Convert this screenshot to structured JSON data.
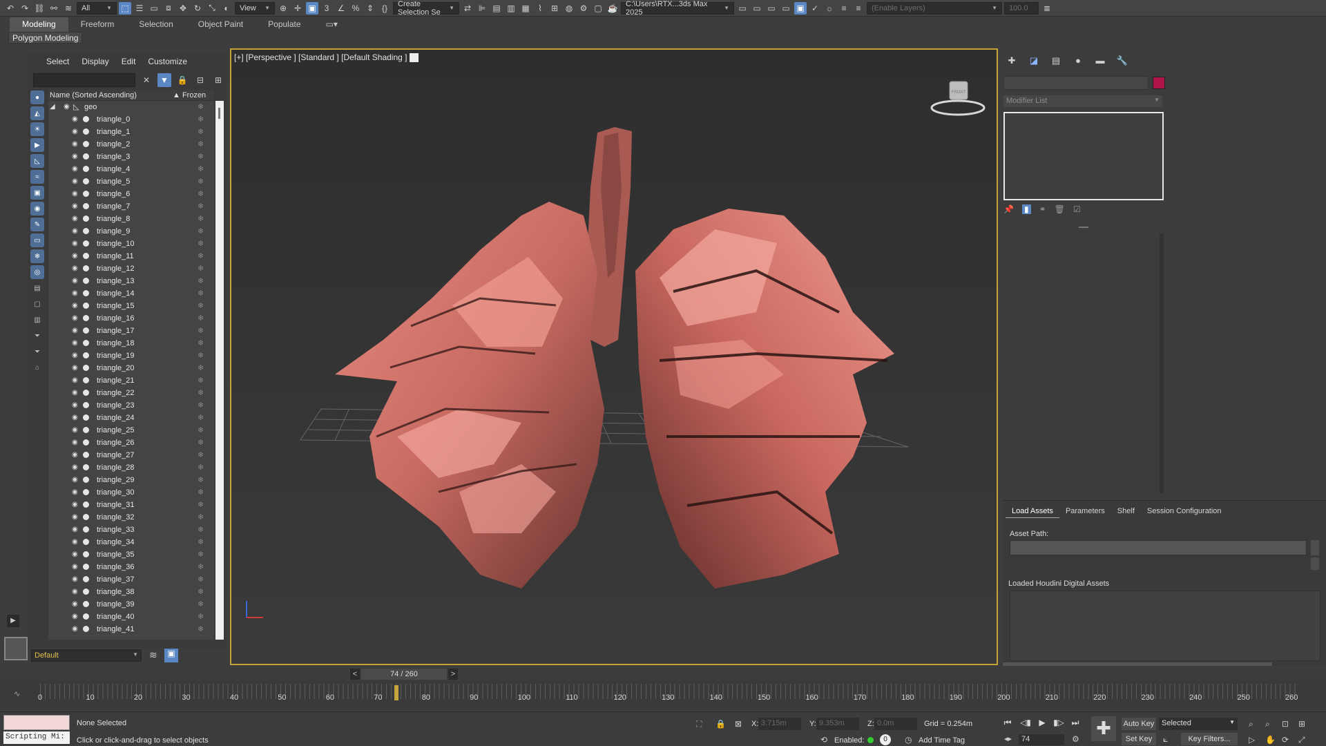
{
  "toolbar": {
    "selection_filter": "All",
    "reference_coord": "View",
    "create_selection_set": "Create Selection Se",
    "project_path": "C:\\Users\\RTX...3ds Max 2025",
    "layers_placeholder": "(Enable Layers)",
    "percent_value": "100.0"
  },
  "ribbon": {
    "tabs": [
      "Modeling",
      "Freeform",
      "Selection",
      "Object Paint",
      "Populate"
    ],
    "sub_label": "Polygon Modeling"
  },
  "explorer": {
    "menu": [
      "Select",
      "Display",
      "Edit",
      "Customize"
    ],
    "col_name": "Name (Sorted Ascending)",
    "col_frozen": "▲ Frozen",
    "group_name": "geo",
    "items": [
      "triangle_0",
      "triangle_1",
      "triangle_2",
      "triangle_3",
      "triangle_4",
      "triangle_5",
      "triangle_6",
      "triangle_7",
      "triangle_8",
      "triangle_9",
      "triangle_10",
      "triangle_11",
      "triangle_12",
      "triangle_13",
      "triangle_14",
      "triangle_15",
      "triangle_16",
      "triangle_17",
      "triangle_18",
      "triangle_19",
      "triangle_20",
      "triangle_21",
      "triangle_22",
      "triangle_23",
      "triangle_24",
      "triangle_25",
      "triangle_26",
      "triangle_27",
      "triangle_28",
      "triangle_29",
      "triangle_30",
      "triangle_31",
      "triangle_32",
      "triangle_33",
      "triangle_34",
      "triangle_35",
      "triangle_36",
      "triangle_37",
      "triangle_38",
      "triangle_39",
      "triangle_40",
      "triangle_41"
    ],
    "layer": "Default"
  },
  "viewport": {
    "label": "[+] [Perspective ] [Standard ] [Default Shading ]",
    "viewcube_face": "FRONT",
    "frame_display": "74 / 260",
    "prev": "<",
    "next": ">"
  },
  "cmdpanel": {
    "modifier_list": "Modifier List",
    "object_color": "#b01548"
  },
  "houdini": {
    "tabs": [
      "Load Assets",
      "Parameters",
      "Shelf",
      "Session Configuration"
    ],
    "asset_path_label": "Asset Path:",
    "loaded_label": "Loaded Houdini Digital Assets"
  },
  "timeline": {
    "ticks": [
      "0",
      "10",
      "20",
      "30",
      "40",
      "50",
      "60",
      "70",
      "80",
      "90",
      "100",
      "110",
      "120",
      "130",
      "140",
      "150",
      "160",
      "170",
      "180",
      "190",
      "200",
      "210",
      "220",
      "230",
      "240",
      "250",
      "260"
    ],
    "current_frame": 74,
    "total_frames": 260
  },
  "status": {
    "selection": "None Selected",
    "prompt": "Click or click-and-drag to select objects",
    "script_listener": "Scripting Mi:",
    "x_label": "X:",
    "x_value": "3.715m",
    "y_label": "Y:",
    "y_value": "9.353m",
    "z_label": "Z:",
    "z_value": "0.0m",
    "grid": "Grid = 0.254m",
    "enabled": "Enabled:",
    "enabled_count": "0",
    "add_time_tag": "Add Time Tag",
    "frame": "74",
    "auto_key": "Auto Key",
    "set_key": "Set Key",
    "key_mode": "Selected",
    "key_filters": "Key Filters..."
  }
}
